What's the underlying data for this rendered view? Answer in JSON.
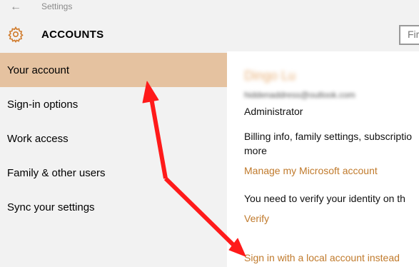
{
  "window": {
    "title": "Settings"
  },
  "header": {
    "title": "ACCOUNTS",
    "search_text": "Fir"
  },
  "sidebar": {
    "items": [
      {
        "label": "Your account"
      },
      {
        "label": "Sign-in options"
      },
      {
        "label": "Work access"
      },
      {
        "label": "Family & other users"
      },
      {
        "label": "Sync your settings"
      }
    ]
  },
  "account": {
    "name": "Dingo Lu",
    "email": "hiddenaddress@outlook.com",
    "role": "Administrator",
    "billing_line1": "Billing info, family settings, subscriptio",
    "billing_line2": "more",
    "manage_link": "Manage my Microsoft account",
    "verify_text": "You need to verify your identity on th",
    "verify_link": "Verify",
    "local_account_link": "Sign in with a local account instead"
  },
  "colors": {
    "accent": "#c07a2c",
    "selected_nav": "#e5c2a0",
    "annotation_arrow": "#ff1a1a"
  }
}
